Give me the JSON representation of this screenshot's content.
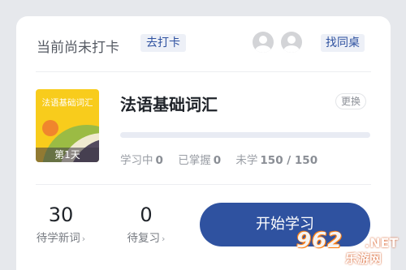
{
  "checkin": {
    "status_text": "当前尚未打卡",
    "button_label": "去打卡",
    "find_deskmate_label": "找同桌"
  },
  "book": {
    "cover_title": "法语基础词汇",
    "day_badge": "第1天",
    "title": "法语基础词汇",
    "change_label": "更换",
    "progress": 0
  },
  "stats": {
    "learning_label": "学习中",
    "learning_value": "0",
    "mastered_label": "已掌握",
    "mastered_value": "0",
    "unlearned_label": "未学",
    "unlearned_value": "150 / 150"
  },
  "counts": {
    "new_words_value": "30",
    "new_words_label": "待学新词",
    "review_value": "0",
    "review_label": "待复习",
    "chevron": "›"
  },
  "start_button_label": "开始学习",
  "watermark": {
    "number": "962",
    "suffix": ".NET",
    "site": "乐游网"
  },
  "colors": {
    "accent": "#2f52a0",
    "cover_yellow": "#f8cc1c",
    "background": "#e6e8ec"
  },
  "icons": [
    "avatar-icon",
    "avatar-icon",
    "chevron-right-icon"
  ]
}
